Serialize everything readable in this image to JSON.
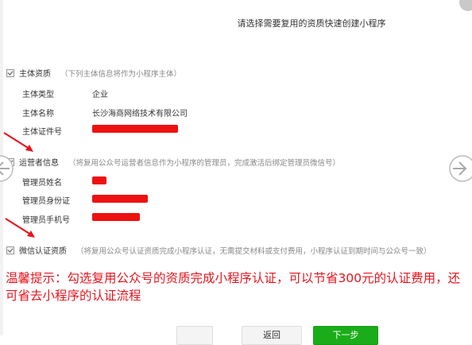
{
  "dialog": {
    "title": "请选择需要复用的资质快速创建小程序"
  },
  "sections": {
    "subject": {
      "title": "主体资质",
      "note": "（下列主体信息将作为小程序主体）",
      "rows": [
        {
          "label": "主体类型",
          "value": "企业"
        },
        {
          "label": "主体名称",
          "value": "长沙海商网络技术有限公司"
        },
        {
          "label": "主体证件号",
          "value": ""
        }
      ]
    },
    "operator": {
      "title": "运营者信息",
      "note": "（将复用公众号运营者信息作为小程序的管理员，完成激活后绑定管理员微信号）",
      "rows": [
        {
          "label": "管理员姓名",
          "value": ""
        },
        {
          "label": "管理员身份证",
          "value": ""
        },
        {
          "label": "管理员手机号",
          "value": ""
        }
      ]
    },
    "wechat_cert": {
      "title": "微信认证资质",
      "note": "（将复用公众号认证资质完成小程序认证，无需提交材料或支付费用，小程序认证到期时间与公众号一致）"
    }
  },
  "tip": {
    "text": "温馨提示：勾选复用公众号的资质完成小程序认证，可以节省300元的认证费用，还可省去小程序的认证流程"
  },
  "buttons": {
    "back_label": "返回",
    "next_label": "下一步"
  },
  "colors": {
    "annotation_red": "#e8141e",
    "primary_green": "#1aad19"
  }
}
